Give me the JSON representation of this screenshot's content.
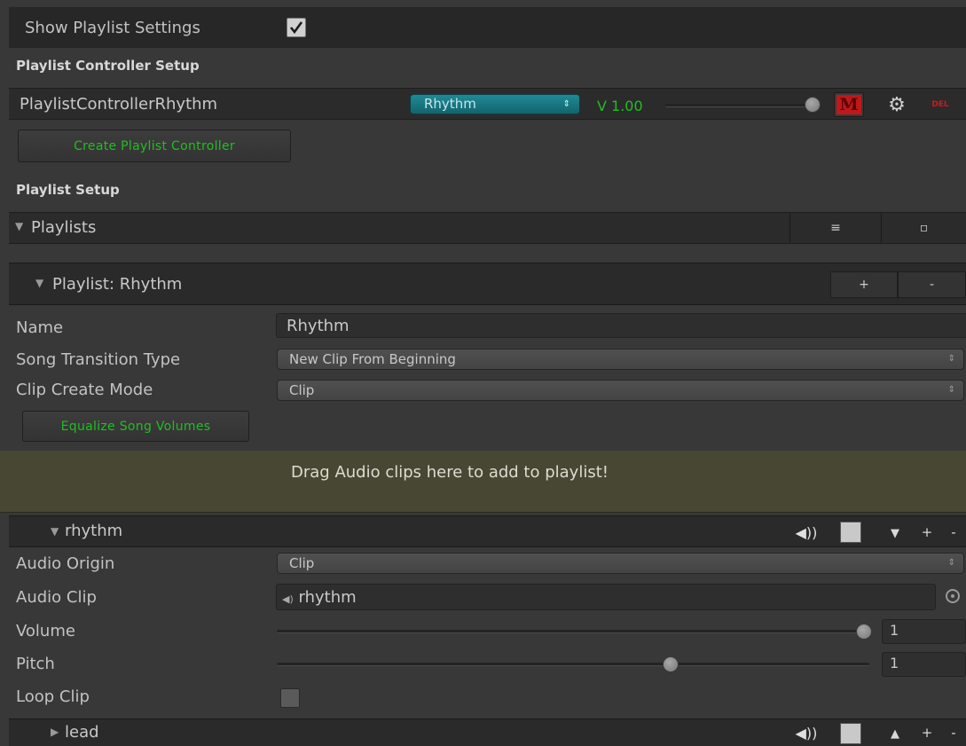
{
  "show_playlist_settings": {
    "label": "Show Playlist Settings",
    "checked": true
  },
  "controller_setup": {
    "section_title": "Playlist Controller Setup",
    "controller_name": "PlaylistControllerRhythm",
    "playlist_select": "Rhythm",
    "volume_label": "V 1.00",
    "volume_value": 1.0,
    "m_button": "M",
    "del_button": "DEL",
    "create_button": "Create Playlist Controller"
  },
  "playlist_setup": {
    "section_title": "Playlist Setup",
    "playlists_header": "Playlists",
    "menu_glyph": "≡",
    "square_glyph": "▫"
  },
  "playlist": {
    "header": "Playlist: Rhythm",
    "add_glyph": "+",
    "remove_glyph": "-",
    "fields": {
      "name_label": "Name",
      "name_value": "Rhythm",
      "transition_label": "Song Transition Type",
      "transition_value": "New Clip From Beginning",
      "create_mode_label": "Clip Create Mode",
      "create_mode_value": "Clip"
    },
    "equalize_button": "Equalize Song Volumes",
    "drop_zone_text": "Drag Audio clips here to add to playlist!"
  },
  "songs": [
    {
      "name": "rhythm",
      "expanded": true,
      "audio_origin_label": "Audio Origin",
      "audio_origin_value": "Clip",
      "audio_clip_label": "Audio Clip",
      "audio_clip_value": "rhythm",
      "volume_label": "Volume",
      "volume_value": "1",
      "volume_fraction": 1.0,
      "pitch_label": "Pitch",
      "pitch_value": "1",
      "pitch_fraction": 0.67,
      "loop_label": "Loop Clip",
      "loop_checked": false
    },
    {
      "name": "lead",
      "expanded": false
    }
  ],
  "colors": {
    "accent_green": "#1fbf1f",
    "select_teal": "#1a6f7a",
    "m_red": "#c0181a",
    "drop_zone": "#484734"
  },
  "icons": [
    "checkbox-icon",
    "gear-icon",
    "speaker-icon",
    "stop-icon",
    "arrow-down-icon",
    "arrow-up-icon",
    "audio-clip-icon",
    "object-picker-icon"
  ]
}
